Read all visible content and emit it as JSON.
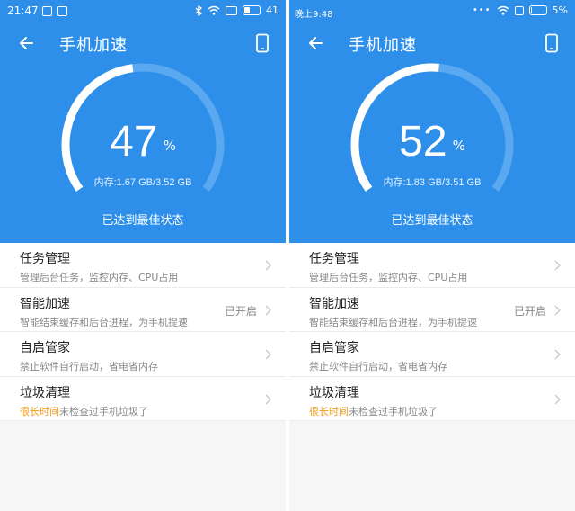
{
  "screens": [
    {
      "status_bar": {
        "time": "21:47",
        "battery": "41",
        "battery_fraction": 0.41
      },
      "toolbar": {
        "title": "手机加速"
      },
      "gauge": {
        "percent": "47",
        "percent_value": 47,
        "unit": "%",
        "memory": "内存:1.67 GB/3.52 GB"
      },
      "status_text": "已达到最佳状态",
      "items": [
        {
          "title": "任务管理",
          "subtitle": "管理后台任务，监控内存、CPU占用",
          "value": ""
        },
        {
          "title": "智能加速",
          "subtitle": "智能结束缓存和后台进程，为手机提速",
          "value": "已开启"
        },
        {
          "title": "自启管家",
          "subtitle": "禁止软件自行启动，省电省内存",
          "value": ""
        },
        {
          "title": "垃圾清理",
          "subtitle_highlight": "很长时间",
          "subtitle": "未检查过手机垃圾了",
          "value": ""
        }
      ]
    },
    {
      "status_bar": {
        "time": "晚上9:48",
        "battery": "5%",
        "battery_fraction": 0.05
      },
      "toolbar": {
        "title": "手机加速"
      },
      "gauge": {
        "percent": "52",
        "percent_value": 52,
        "unit": "%",
        "memory": "内存:1.83 GB/3.51 GB"
      },
      "status_text": "已达到最佳状态",
      "items": [
        {
          "title": "任务管理",
          "subtitle": "管理后台任务，监控内存、CPU占用",
          "value": ""
        },
        {
          "title": "智能加速",
          "subtitle": "智能结束缓存和后台进程，为手机提速",
          "value": "已开启"
        },
        {
          "title": "自启管家",
          "subtitle": "禁止软件自行启动，省电省内存",
          "value": ""
        },
        {
          "title": "垃圾清理",
          "subtitle_highlight": "很长时间",
          "subtitle": "未检查过手机垃圾了",
          "value": ""
        }
      ]
    }
  ],
  "colors": {
    "primary": "#2d8fea",
    "highlight": "#f39c12",
    "track": "#5aa8ef"
  },
  "icons": {
    "back": "arrow-left-icon",
    "device": "phone-icon",
    "chevron": "chevron-right-icon",
    "wifi": "wifi-icon",
    "bluetooth": "bluetooth-icon"
  }
}
